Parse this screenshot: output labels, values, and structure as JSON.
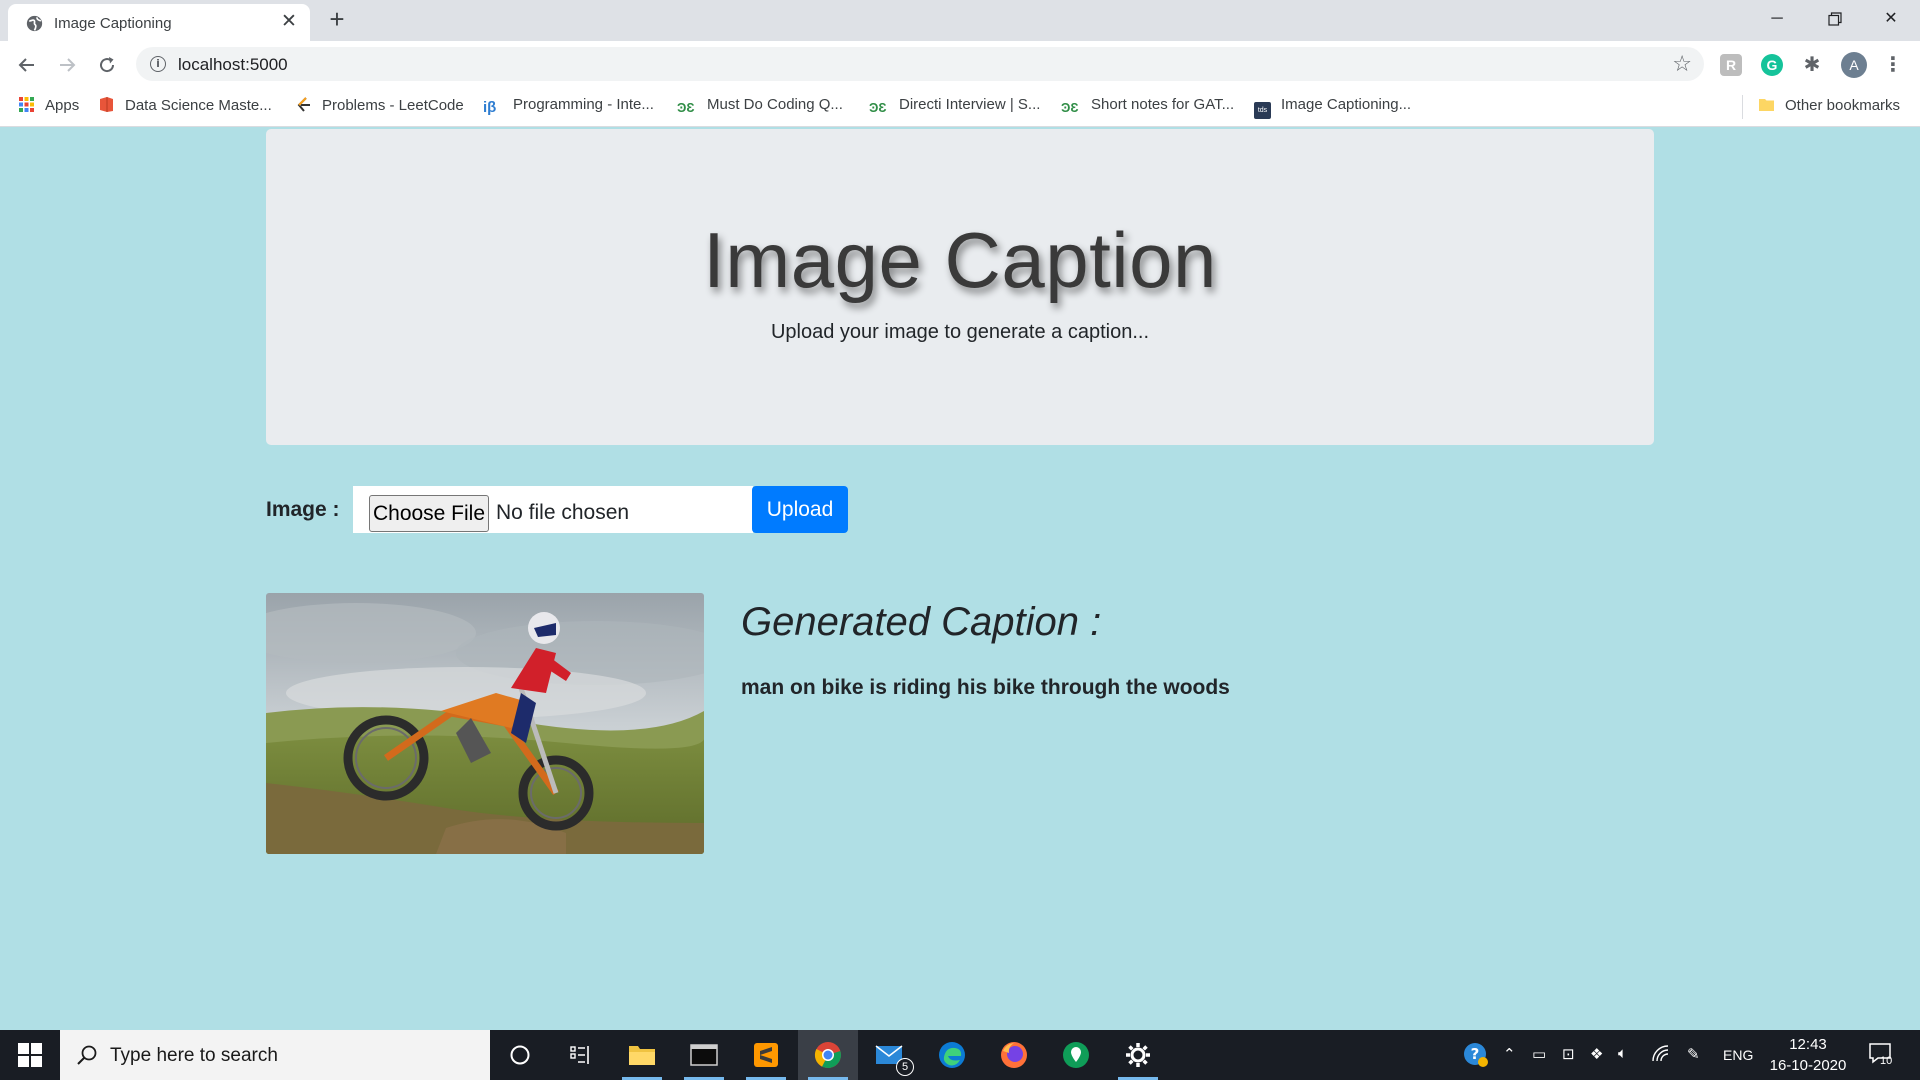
{
  "browser": {
    "tab_title": "Image Captioning",
    "url": "localhost:5000",
    "profile_initial": "A",
    "bookmarks": [
      {
        "label": "Apps",
        "icon": "apps-grid-icon"
      },
      {
        "label": "Data Science Maste...",
        "icon": "book-icon"
      },
      {
        "label": "Problems - LeetCode",
        "icon": "leetcode-icon"
      },
      {
        "label": "Programming - Inte...",
        "icon": "interviewbit-icon"
      },
      {
        "label": "Must Do Coding Q...",
        "icon": "geeksforgeeks-icon"
      },
      {
        "label": "Directi Interview | S...",
        "icon": "geeksforgeeks-icon"
      },
      {
        "label": "Short notes for GAT...",
        "icon": "geeksforgeeks-icon"
      },
      {
        "label": "Image Captioning...",
        "icon": "tds-icon"
      }
    ],
    "other_bookmarks": "Other bookmarks"
  },
  "page": {
    "title": "Image Caption",
    "subtitle": "Upload your image to generate a caption...",
    "form": {
      "label": "Image :",
      "choose_file": "Choose File",
      "no_file": "No file chosen",
      "upload": "Upload"
    },
    "caption_heading": "Generated Caption :",
    "caption_text": "man on bike is riding his bike through the woods"
  },
  "taskbar": {
    "search_placeholder": "Type here to search",
    "mail_badge": "5",
    "language": "ENG",
    "time": "12:43",
    "date": "16-10-2020",
    "notification_count": "10"
  },
  "colors": {
    "page_background": "#b0dfe5",
    "jumbotron": "#e9ecef",
    "primary": "#007bff"
  }
}
